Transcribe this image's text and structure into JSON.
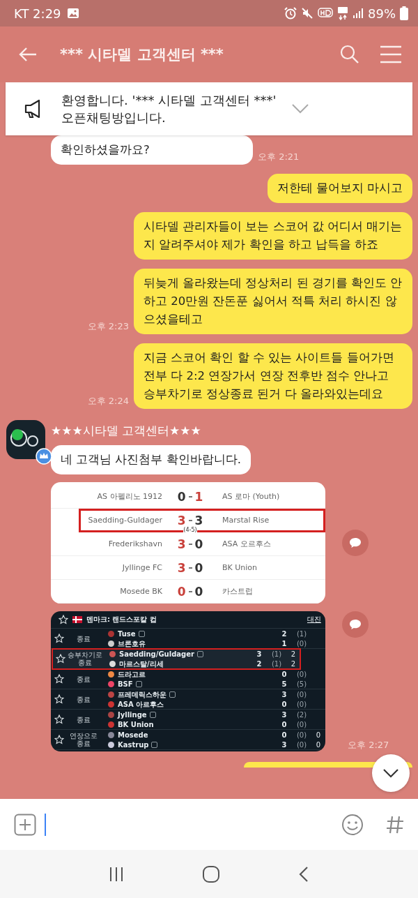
{
  "status_bar": {
    "carrier_time": "KT 2:29",
    "battery": "89%"
  },
  "header": {
    "title": "*** 시타델 고객센터 ***"
  },
  "notice": {
    "text": "환영합니다. '*** 시타델 고객센터 ***' 오픈채팅방입니다.",
    "expanded": false
  },
  "messages": [
    {
      "kind": "incoming",
      "text": "확인하셨을까요?",
      "time": "오후 2:21"
    },
    {
      "kind": "outgoing",
      "text": "저한테 물어보지 마시고"
    },
    {
      "kind": "outgoing",
      "text": "시타델 관리자들이 보는 스코어 값 어디서 매기는지 알려주셔야 제가 확인을 하고 납득을 하죠"
    },
    {
      "kind": "outgoing",
      "text": "뒤늦게 올라왔는데 정상처리 된 경기를 확인도 안하고 20만원 잔돈푼 싫어서 적특 처리 하시진 않으셨을테고",
      "time": "오후 2:23"
    },
    {
      "kind": "outgoing",
      "text": "지금 스코어 확인 할 수 있는 사이트들 들어가면 전부 다 2:2 연장가서 연장 전후반 점수 안나고 승부차기로 정상종료 된거 다 올라와있는데요",
      "time": "오후 2:24"
    },
    {
      "kind": "incoming",
      "sender": "★★★시타델 고객센터★★★",
      "text": "네 고객님 사진첨부 확인바랍니다."
    },
    {
      "kind": "light_scores",
      "rows": [
        {
          "home": "AS 아펠리노 1912",
          "home_score": "0",
          "away_score": "1",
          "away": "AS 로마 (Youth)",
          "home_won": false,
          "highlighted": false
        },
        {
          "home": "Saedding-Guldager",
          "home_score": "3",
          "away_score": "3",
          "away": "Marstal Rise",
          "note": "(4-5)",
          "home_won": true,
          "highlighted": true
        },
        {
          "home": "Frederikshavn",
          "home_score": "3",
          "away_score": "0",
          "away": "ASA 오르후스",
          "home_won": true,
          "highlighted": false
        },
        {
          "home": "Jyllinge FC",
          "home_score": "3",
          "away_score": "0",
          "away": "BK Union",
          "home_won": true,
          "highlighted": false
        },
        {
          "home": "Mosede BK",
          "home_score": "0",
          "away_score": "0",
          "away": "카스트럽",
          "home_won": true,
          "highlighted": false
        }
      ]
    },
    {
      "kind": "dark_scores",
      "league": "덴마크: 랜드스포칼 컵",
      "link": "대진",
      "time": "오후 2:27",
      "matches": [
        {
          "status": "종료",
          "highlighted": false,
          "teams": [
            {
              "name": "Tuse",
              "info": true,
              "score": "2",
              "half": "(1)"
            },
            {
              "name": "브론호유",
              "info": false,
              "score": "1",
              "half": "(0)"
            }
          ]
        },
        {
          "status": "승부차기로 종료",
          "highlighted": true,
          "teams": [
            {
              "name": "Saedding/Guldager",
              "info": true,
              "score": "3",
              "half": "(1)",
              "pens": "2"
            },
            {
              "name": "마르스탈/리세",
              "info": false,
              "score": "2",
              "half": "(1)",
              "pens": "2"
            }
          ]
        },
        {
          "status": "종료",
          "highlighted": false,
          "teams": [
            {
              "name": "드라고르",
              "info": false,
              "score": "0",
              "half": "(0)"
            },
            {
              "name": "BSF",
              "info": true,
              "score": "5",
              "half": "(5)"
            }
          ]
        },
        {
          "status": "종료",
          "highlighted": false,
          "teams": [
            {
              "name": "프레데릭스하운",
              "info": true,
              "score": "3",
              "half": "(0)"
            },
            {
              "name": "ASA 아르후스",
              "info": false,
              "score": "0",
              "half": "(0)"
            }
          ]
        },
        {
          "status": "종료",
          "highlighted": false,
          "teams": [
            {
              "name": "Jyllinge",
              "info": true,
              "score": "3",
              "half": "(2)"
            },
            {
              "name": "BK Union",
              "info": false,
              "score": "0",
              "half": "(0)"
            }
          ]
        },
        {
          "status": "연장으로 종료",
          "highlighted": false,
          "teams": [
            {
              "name": "Mosede",
              "info": false,
              "score": "0",
              "half": "(0)",
              "pens": "0"
            },
            {
              "name": "Kastrup",
              "info": true,
              "score": "3",
              "half": "(0)",
              "pens": "0"
            }
          ]
        }
      ]
    },
    {
      "kind": "outgoing_cut"
    }
  ]
}
